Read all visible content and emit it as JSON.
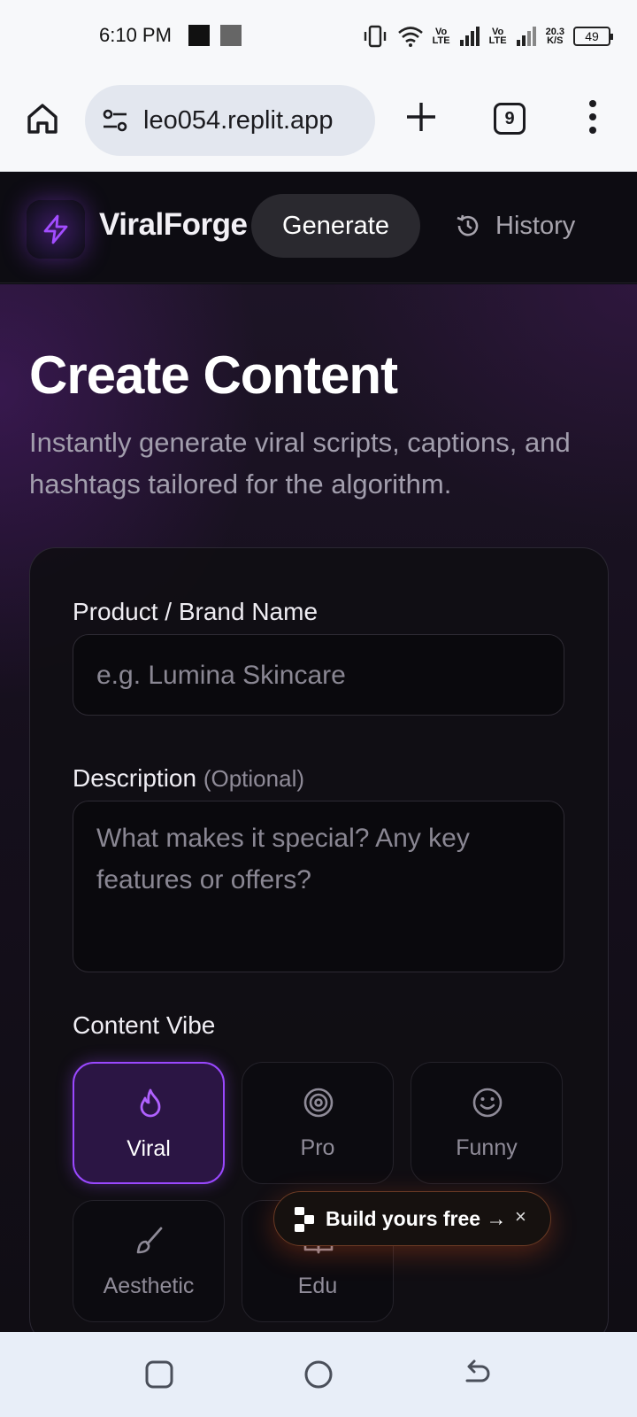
{
  "status_bar": {
    "time": "6:10 PM",
    "net1": "Vo\nLTE",
    "net2": "Vo\nLTE",
    "speed": "20.3\nK/S",
    "battery": "49"
  },
  "browser": {
    "url": "leo054.replit.app",
    "tab_count": "9"
  },
  "header": {
    "brand": "ViralForge",
    "nav_generate": "Generate",
    "nav_history": "History",
    "accent_color": "#9a48ff"
  },
  "main": {
    "title": "Create Content",
    "subtitle": "Instantly generate viral scripts, captions, and hashtags tailored for the algorithm.",
    "form": {
      "product_label": "Product / Brand Name",
      "product_placeholder": "e.g. Lumina Skincare",
      "description_label": "Description",
      "description_optional": "(Optional)",
      "description_placeholder": "What makes it special? Any key features or offers?",
      "vibe_label": "Content Vibe",
      "vibes": [
        {
          "label": "Viral",
          "icon": "flame-icon",
          "selected": true
        },
        {
          "label": "Pro",
          "icon": "target-icon",
          "selected": false
        },
        {
          "label": "Funny",
          "icon": "smile-icon",
          "selected": false
        },
        {
          "label": "Aesthetic",
          "icon": "brush-icon",
          "selected": false
        },
        {
          "label": "Edu",
          "icon": "book-icon",
          "selected": false
        }
      ]
    }
  },
  "promo": {
    "text": "Build yours free →",
    "close": "×"
  }
}
